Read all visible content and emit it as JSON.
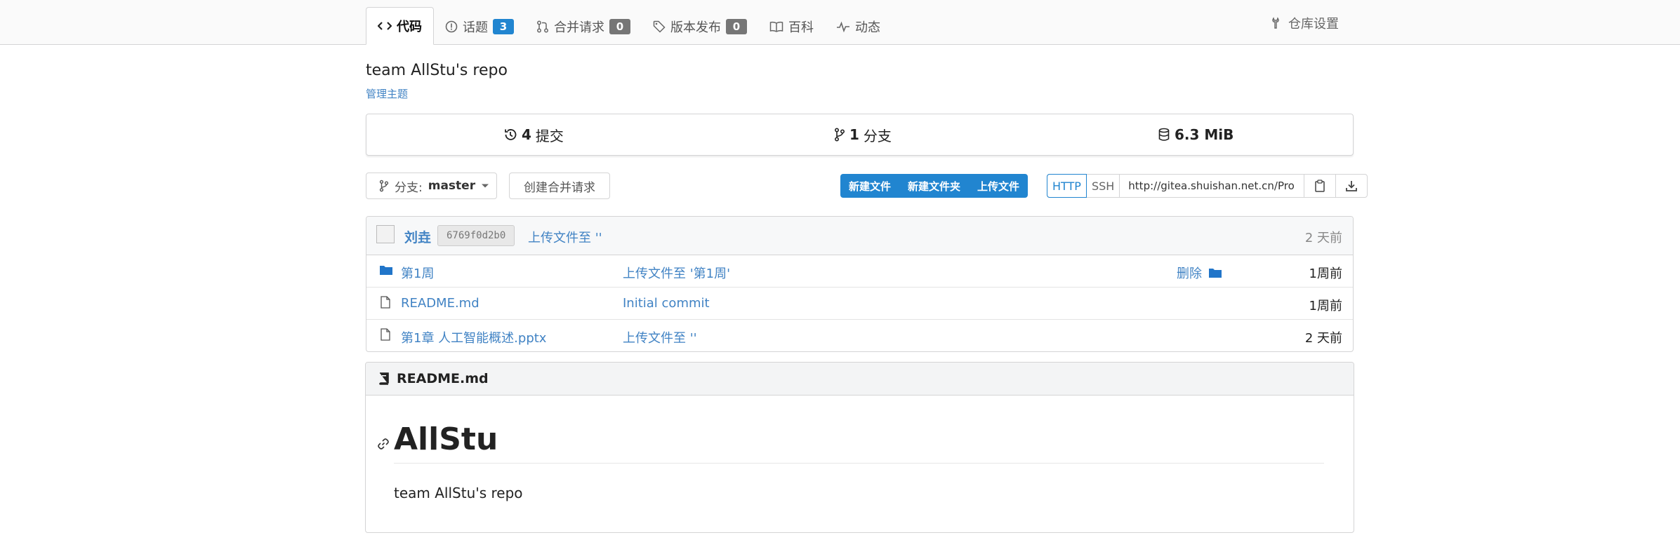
{
  "tabs": {
    "code": "代码",
    "issues": "话题",
    "issues_count": "3",
    "pulls": "合并请求",
    "pulls_count": "0",
    "releases": "版本发布",
    "releases_count": "0",
    "wiki": "百科",
    "activity": "动态",
    "settings": "仓库设置"
  },
  "repo": {
    "description": "team AllStu's repo",
    "manage_topics": "管理主题"
  },
  "stats": {
    "commits_count": "4",
    "commits_label": "提交",
    "branches_count": "1",
    "branches_label": "分支",
    "size": "6.3 MiB"
  },
  "toolbar": {
    "branch_prefix": "分支:",
    "branch_name": "master",
    "create_pr": "创建合并请求",
    "new_file": "新建文件",
    "new_folder": "新建文件夹",
    "upload_file": "上传文件",
    "http": "HTTP",
    "ssh": "SSH",
    "clone_url": "http://gitea.shuishan.net.cn/Pro"
  },
  "latest_commit": {
    "author": "刘垚",
    "sha": "6769f0d2b0",
    "message": "上传文件至 ''",
    "age": "2 天前"
  },
  "files": [
    {
      "name": "第1周",
      "type": "folder",
      "message": "上传文件至 '第1周'",
      "action": "删除",
      "age": "1周前"
    },
    {
      "name": "README.md",
      "type": "file",
      "message": "Initial commit",
      "age": "1周前"
    },
    {
      "name": "第1章 人工智能概述.pptx",
      "type": "file",
      "message": "上传文件至 ''",
      "age": "2 天前"
    }
  ],
  "readme": {
    "filename": "README.md",
    "heading": "AllStu",
    "body": "team AllStu's repo"
  },
  "colors": {
    "accent": "#2185d0",
    "link": "#4183c4",
    "badge_gray": "#767676"
  }
}
